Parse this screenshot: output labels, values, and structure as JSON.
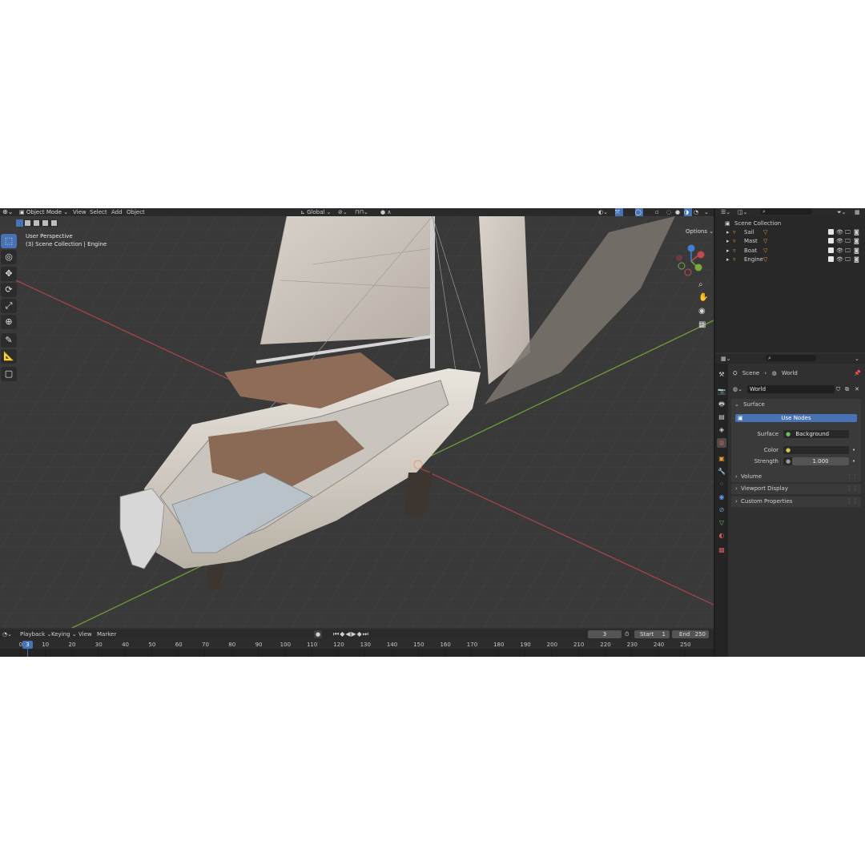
{
  "header": {
    "mode": "Object Mode",
    "menus": [
      "View",
      "Select",
      "Add",
      "Object"
    ],
    "orientation": "Global",
    "options": "Options"
  },
  "viewport": {
    "view_name": "User Perspective",
    "context": "(3) Scene Collection | Engine",
    "colors": {
      "x_axis": "#c4484f",
      "y_axis": "#7aa83b",
      "z_axis": "#3f7fd6",
      "background": "#393939"
    }
  },
  "outliner": {
    "root": "Scene Collection",
    "items": [
      "Sail",
      "Mast",
      "Boat",
      "Engine"
    ]
  },
  "properties": {
    "breadcrumb_scene": "Scene",
    "breadcrumb_world": "World",
    "world_name": "World",
    "surface_panel": "Surface",
    "use_nodes": "Use Nodes",
    "surface_label": "Surface",
    "surface_value": "Background",
    "color_label": "Color",
    "strength_label": "Strength",
    "strength_value": "1.000",
    "panels": [
      "Volume",
      "Viewport Display",
      "Custom Properties"
    ]
  },
  "timeline": {
    "menus": [
      "Playback",
      "Keying",
      "View",
      "Marker"
    ],
    "current_frame": "3",
    "start_label": "Start",
    "start_value": "1",
    "end_label": "End",
    "end_value": "250",
    "ruler": [
      "0",
      "10",
      "20",
      "30",
      "40",
      "50",
      "60",
      "70",
      "80",
      "90",
      "100",
      "110",
      "120",
      "130",
      "140",
      "150",
      "160",
      "170",
      "180",
      "190",
      "200",
      "210",
      "220",
      "230",
      "240",
      "250"
    ],
    "playhead_label": "3"
  }
}
